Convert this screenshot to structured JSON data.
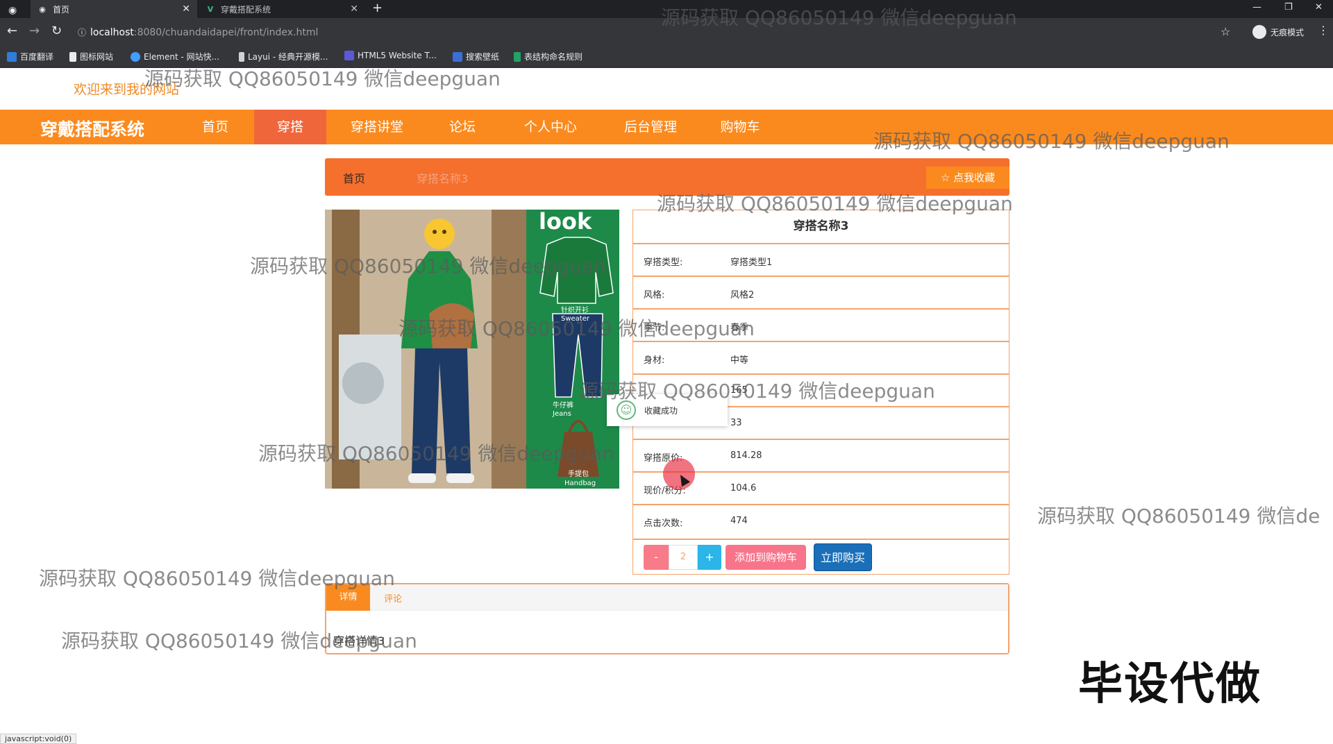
{
  "browser": {
    "tabs": [
      {
        "title": "首页",
        "active": true
      },
      {
        "title": "穿戴搭配系统",
        "active": false
      }
    ],
    "url_host": "localhost",
    "url_path": ":8080/chuandaidapei/front/index.html",
    "incognito_label": "无痕模式",
    "bookmarks": [
      "百度翻译",
      "图标网站",
      "Element - 网站快...",
      "Layui - 经典开源模...",
      "HTML5 Website T...",
      "搜索壁纸",
      "表结构命名规则"
    ]
  },
  "site": {
    "welcome": "欢迎来到我的网站",
    "brand": "穿戴搭配系统",
    "nav": [
      "首页",
      "穿搭",
      "穿搭讲堂",
      "论坛",
      "个人中心",
      "后台管理",
      "购物车"
    ],
    "active_nav": "穿搭"
  },
  "breadcrumb": {
    "home": "首页",
    "current": "穿搭名称3",
    "collect_button": "☆ 点我收藏"
  },
  "product": {
    "title": "穿搭名称3",
    "image_labels": {
      "look": "look",
      "sweater_cn": "针织开衫",
      "sweater_en": "Sweater",
      "jeans_cn": "牛仔裤",
      "jeans_en": "Jeans",
      "bag_cn": "手提包",
      "bag_en": "Handbag"
    },
    "fields": [
      {
        "label": "穿搭类型:",
        "value": "穿搭类型1"
      },
      {
        "label": "风格:",
        "value": "风格2"
      },
      {
        "label": "季节:",
        "value": "春季"
      },
      {
        "label": "身材:",
        "value": "中等"
      },
      {
        "label": "",
        "value": "165"
      },
      {
        "label": "",
        "value": "33"
      },
      {
        "label": "穿搭原价:",
        "value": "814.28"
      },
      {
        "label": "现价/积分:",
        "value": "104.6"
      },
      {
        "label": "点击次数:",
        "value": "474"
      }
    ],
    "quantity": "2",
    "minus": "-",
    "plus": "+",
    "add_to_cart": "添加到购物车",
    "buy_now": "立即购买"
  },
  "detail_tabs": {
    "tabs": [
      "详情",
      "评论"
    ],
    "content": "穿搭详情3"
  },
  "toast": {
    "text": "收藏成功"
  },
  "status_bar": "javascript:void(0)",
  "watermark": "源码获取 QQ86050149 微信deepguan",
  "watermark_cut": "源码获取 QQ86050149 微信de",
  "stamp": "毕设代做",
  "colors": {
    "nav_bg": "#fb8a1e",
    "nav_active": "#f0663b",
    "breadcrumb_bg": "#f56f2d",
    "border": "#f5a36b",
    "buy_button": "#1a6fb8",
    "cart_button": "#f7748a"
  }
}
